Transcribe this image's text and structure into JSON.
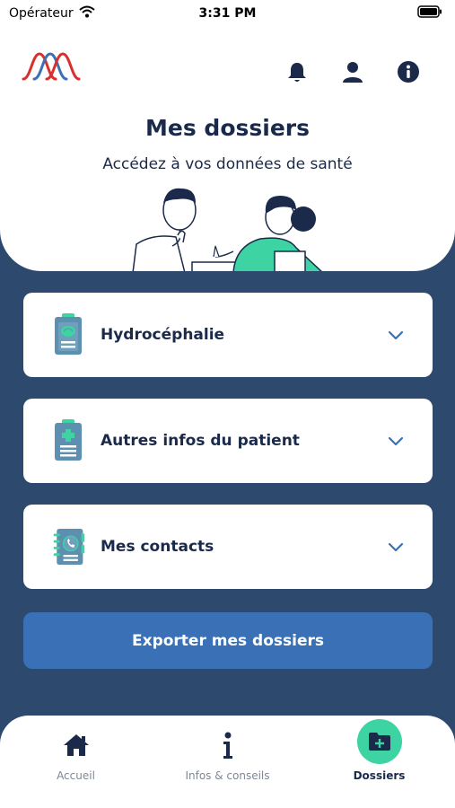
{
  "status_bar": {
    "carrier": "Opérateur",
    "time": "3:31 PM"
  },
  "header": {
    "title": "Mes dossiers",
    "subtitle": "Accédez à vos données de santé",
    "icons": [
      "bell-icon",
      "user-icon",
      "info-icon"
    ]
  },
  "cards": [
    {
      "label": "Hydrocéphalie",
      "icon": "brain-clipboard-icon"
    },
    {
      "label": "Autres infos du patient",
      "icon": "medical-clipboard-icon"
    },
    {
      "label": "Mes contacts",
      "icon": "phone-book-icon"
    }
  ],
  "export_button": {
    "label": "Exporter mes dossiers"
  },
  "tabbar": {
    "tabs": [
      {
        "label": "Accueil",
        "icon": "home-icon",
        "active": false
      },
      {
        "label": "Infos & conseils",
        "icon": "info-i-icon",
        "active": false
      },
      {
        "label": "Dossiers",
        "icon": "folder-plus-icon",
        "active": true
      }
    ]
  },
  "colors": {
    "background": "#2d4a6e",
    "primary_button": "#3a70b5",
    "accent_green": "#3ed3a2",
    "dark_text": "#1b2a4a"
  }
}
